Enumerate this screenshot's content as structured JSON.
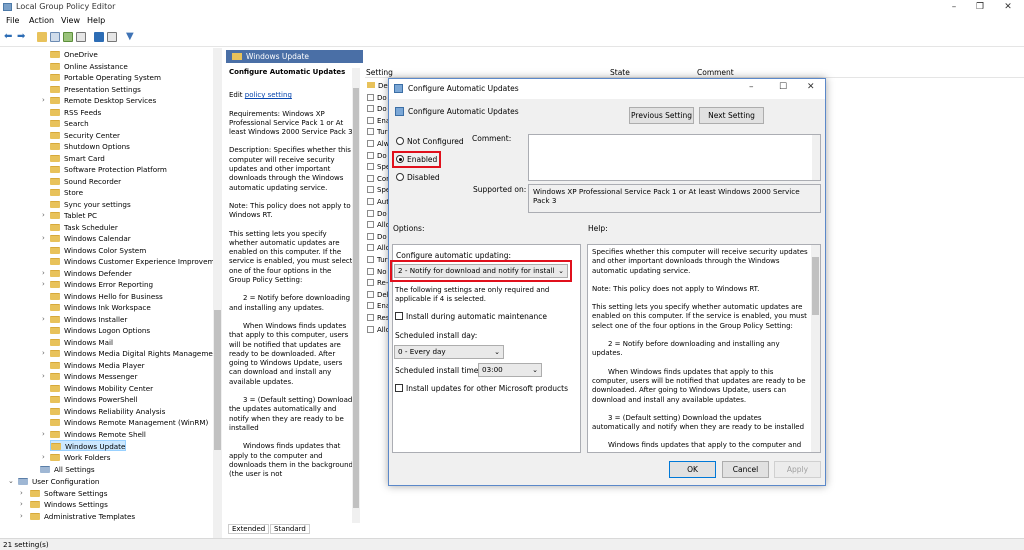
{
  "window": {
    "title": "Local Group Policy Editor",
    "controls": [
      "–",
      "❐",
      "✕"
    ]
  },
  "menu": [
    "File",
    "Action",
    "View",
    "Help"
  ],
  "tree": {
    "items": [
      "OneDrive",
      "Online Assistance",
      "Portable Operating System",
      "Presentation Settings",
      "Remote Desktop Services",
      "RSS Feeds",
      "Search",
      "Security Center",
      "Shutdown Options",
      "Smart Card",
      "Software Protection Platform",
      "Sound Recorder",
      "Store",
      "Sync your settings",
      "Tablet PC",
      "Task Scheduler",
      "Windows Calendar",
      "Windows Color System",
      "Windows Customer Experience Improveme",
      "Windows Defender",
      "Windows Error Reporting",
      "Windows Hello for Business",
      "Windows Ink Workspace",
      "Windows Installer",
      "Windows Logon Options",
      "Windows Mail",
      "Windows Media Digital Rights Managemen",
      "Windows Media Player",
      "Windows Messenger",
      "Windows Mobility Center",
      "Windows PowerShell",
      "Windows Reliability Analysis",
      "Windows Remote Management (WinRM)",
      "Windows Remote Shell",
      "Windows Update",
      "Work Folders"
    ],
    "all_settings": "All Settings",
    "user_config": "User Configuration",
    "user_children": [
      "Software Settings",
      "Windows Settings",
      "Administrative Templates"
    ]
  },
  "middle": {
    "header": "Windows Update",
    "title": "Configure Automatic Updates",
    "edit_prefix": "Edit ",
    "edit_link": "policy setting",
    "requirements": "Requirements: Windows XP Professional Service Pack 1 or At least Windows 2000 Service Pack 3",
    "description": "Description: Specifies whether this computer will receive security updates and other important downloads through the Windows automatic updating service.",
    "note": "Note: This policy does not apply to Windows RT.",
    "para1": "This setting lets you specify whether automatic updates are enabled on this computer. If the service is enabled, you must select one of the four options in the Group Policy Setting:",
    "para2": "2 = Notify before downloading and installing any updates.",
    "para3": "When Windows finds updates that apply to this computer, users will be notified that updates are ready to be downloaded. After going to Windows Update, users can download and install any available updates.",
    "para4": "3 = (Default setting) Download the updates automatically and notify when they are ready to be installed",
    "para5": "Windows finds updates that apply to the computer and downloads them in the background (the user is not"
  },
  "list": {
    "col_setting": "Setting",
    "col_state": "State",
    "col_comment": "Comment",
    "rows": [
      "Def",
      "Do",
      "Do",
      "Ena",
      "Tur",
      "Alw",
      "Do",
      "Spe",
      "Cor",
      "Spe",
      "Aut",
      "Do",
      "Allo",
      "Do",
      "Allo",
      "Tur",
      "No",
      "Re-",
      "Del",
      "Ena",
      "Res",
      "Allo"
    ]
  },
  "tabs": [
    "Extended",
    "Standard"
  ],
  "status": "21 setting(s)",
  "dialog": {
    "title": "Configure Automatic Updates",
    "policy_name": "Configure Automatic Updates",
    "prev_btn": "Previous Setting",
    "next_btn": "Next Setting",
    "radio_not_configured": "Not Configured",
    "radio_enabled": "Enabled",
    "radio_disabled": "Disabled",
    "selected_radio": "Enabled",
    "comment_label": "Comment:",
    "supported_label": "Supported on:",
    "supported_value": "Windows XP Professional Service Pack 1 or At least Windows 2000 Service Pack 3",
    "options_label": "Options:",
    "help_label": "Help:",
    "configure_label": "Configure automatic updating:",
    "configure_value": "2 - Notify for download and notify for install",
    "following_note": "The following settings are only required and applicable if 4 is selected.",
    "install_maint": "Install during automatic maintenance",
    "sched_day_label": "Scheduled install day:",
    "sched_day_value": "0 - Every day",
    "sched_time_label": "Scheduled install time:",
    "sched_time_value": "03:00",
    "install_other": "Install updates for other Microsoft products",
    "help_p1": "Specifies whether this computer will receive security updates and other important downloads through the Windows automatic updating service.",
    "help_p2": "Note: This policy does not apply to Windows RT.",
    "help_p3": "This setting lets you specify whether automatic updates are enabled on this computer. If the service is enabled, you must select one of the four options in the Group Policy Setting:",
    "help_p4": "2 = Notify before downloading and installing any updates.",
    "help_p5": "When Windows finds updates that apply to this computer, users will be notified that updates are ready to be downloaded. After going to Windows Update, users can download and install any available updates.",
    "help_p6": "3 = (Default setting) Download the updates automatically and notify when they are ready to be installed",
    "help_p7": "Windows finds updates that apply to the computer and",
    "ok": "OK",
    "cancel": "Cancel",
    "apply": "Apply"
  },
  "colors": {
    "accent": "#0078d7",
    "highlight": "#e0101c",
    "header_bg": "#4a6fa6",
    "folder": "#e8c25b"
  }
}
